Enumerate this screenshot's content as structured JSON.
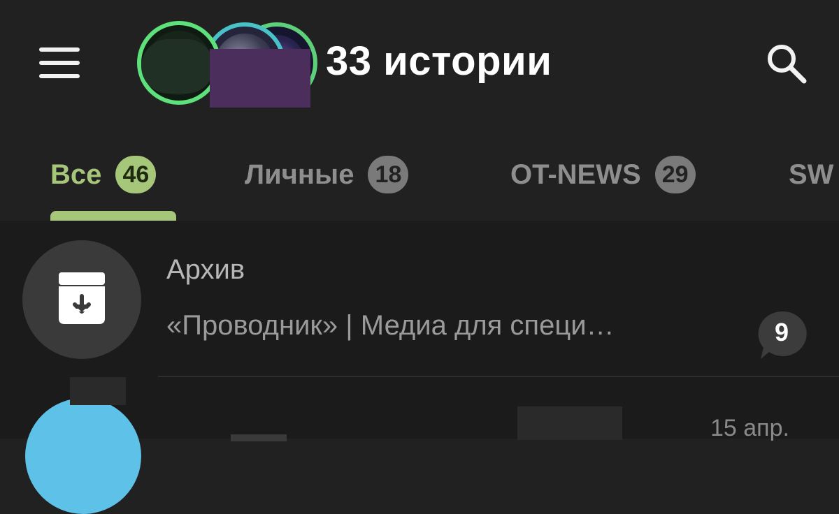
{
  "header": {
    "stories_title": "33 истории"
  },
  "tabs": [
    {
      "label": "Все",
      "count": "46",
      "active": true
    },
    {
      "label": "Личные",
      "count": "18",
      "active": false
    },
    {
      "label": "OT-NEWS",
      "count": "29",
      "active": false
    },
    {
      "label": "SW",
      "count": "",
      "active": false
    }
  ],
  "archive": {
    "title": "Архив",
    "preview": "«Проводник» | Медиа для специ…",
    "unread": "9"
  },
  "chat": {
    "time": "15 апр."
  },
  "colors": {
    "accent": "#a6c67a",
    "background": "#212121",
    "list_background": "#1b1b1b",
    "badge_inactive": "#7a7a7a",
    "story_ring_green": "#5ee07a",
    "story_ring_teal": "#49c2c7"
  },
  "icons": {
    "menu": "hamburger-menu-icon",
    "search": "search-icon",
    "archive": "archive-box-icon"
  }
}
